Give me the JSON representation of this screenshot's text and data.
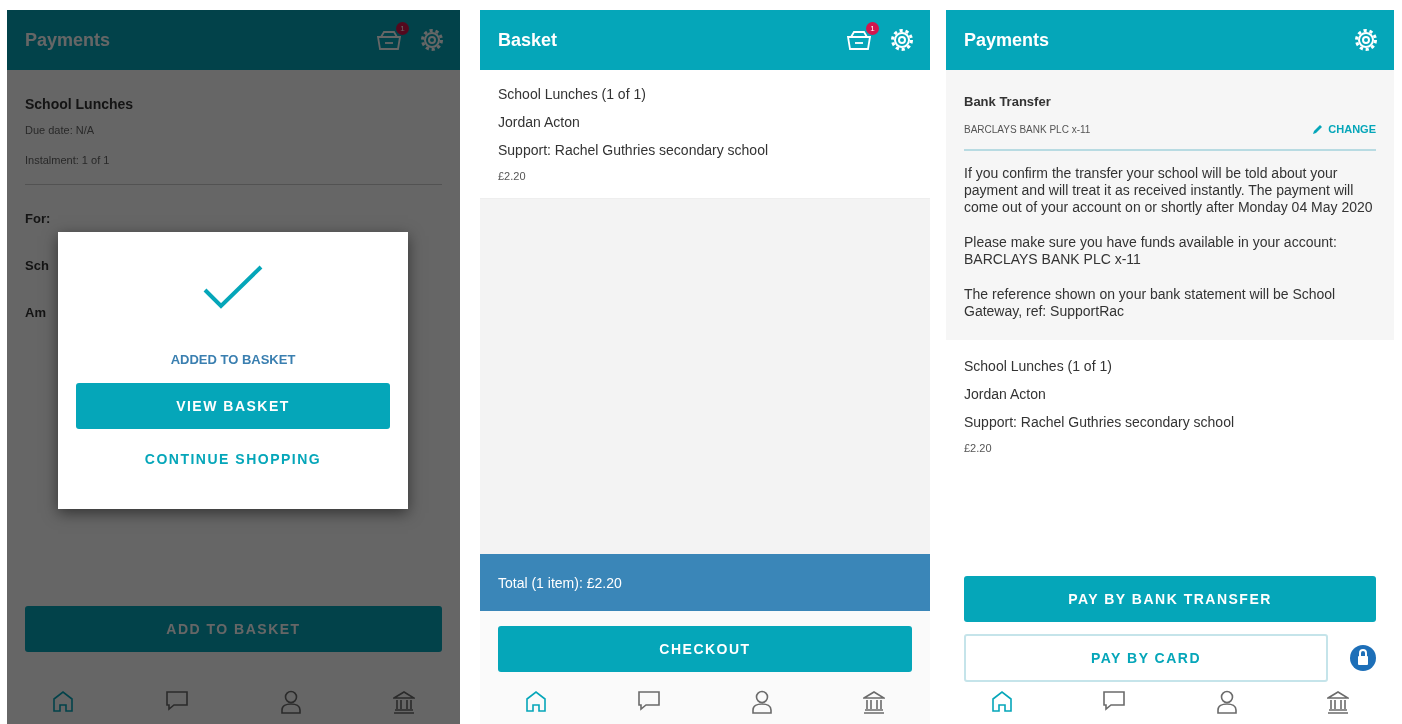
{
  "product_screen": {
    "title": "Payments",
    "basket_badge": "1",
    "item_title": "School Lunches",
    "details": [
      "Due date: N/A",
      "Instalment: 1 of 1"
    ],
    "field_labels": [
      "For:",
      "Sch",
      "Am"
    ],
    "add_button": "ADD TO BASKET",
    "dialog": {
      "message": "ADDED TO BASKET",
      "primary": "VIEW BASKET",
      "secondary": "CONTINUE SHOPPING"
    },
    "nav": [
      {
        "kind": "home",
        "selected": true
      },
      {
        "kind": "chat",
        "selected": false
      },
      {
        "kind": "person",
        "selected": false
      },
      {
        "kind": "bank",
        "selected": false
      }
    ]
  },
  "basket_screen": {
    "title": "Basket",
    "basket_badge": "1",
    "item": {
      "lines": [
        "School Lunches (1 of 1)",
        "Jordan Acton",
        "Support: Rachel Guthries secondary school"
      ],
      "price": "£2.20"
    },
    "total": "Total (1 item): £2.20",
    "checkout": "CHECKOUT",
    "nav": [
      {
        "kind": "home",
        "selected": true
      },
      {
        "kind": "chat",
        "selected": false
      },
      {
        "kind": "person",
        "selected": false
      },
      {
        "kind": "bank",
        "selected": false
      }
    ]
  },
  "payment_screen": {
    "title": "Payments",
    "method_title": "Bank Transfer",
    "account": "BARCLAYS BANK PLC x-11",
    "change": "CHANGE",
    "paragraphs": [
      "If you confirm the transfer your school will be told about your payment and will treat it as received instantly. The payment will come out of your account on or shortly after Monday 04 May 2020",
      "Please make sure you have funds available in your account: BARCLAYS BANK PLC x-11",
      "The reference shown on your bank statement will be School Gateway, ref: SupportRac"
    ],
    "item": {
      "lines": [
        "School Lunches (1 of 1)",
        "Jordan Acton",
        "Support: Rachel Guthries secondary school"
      ],
      "price": "£2.20"
    },
    "pay_bank": "PAY BY BANK TRANSFER",
    "pay_card": "PAY BY CARD",
    "nav": [
      {
        "kind": "home",
        "selected": true
      },
      {
        "kind": "chat",
        "selected": false
      },
      {
        "kind": "person",
        "selected": false
      },
      {
        "kind": "bank",
        "selected": false
      }
    ]
  }
}
